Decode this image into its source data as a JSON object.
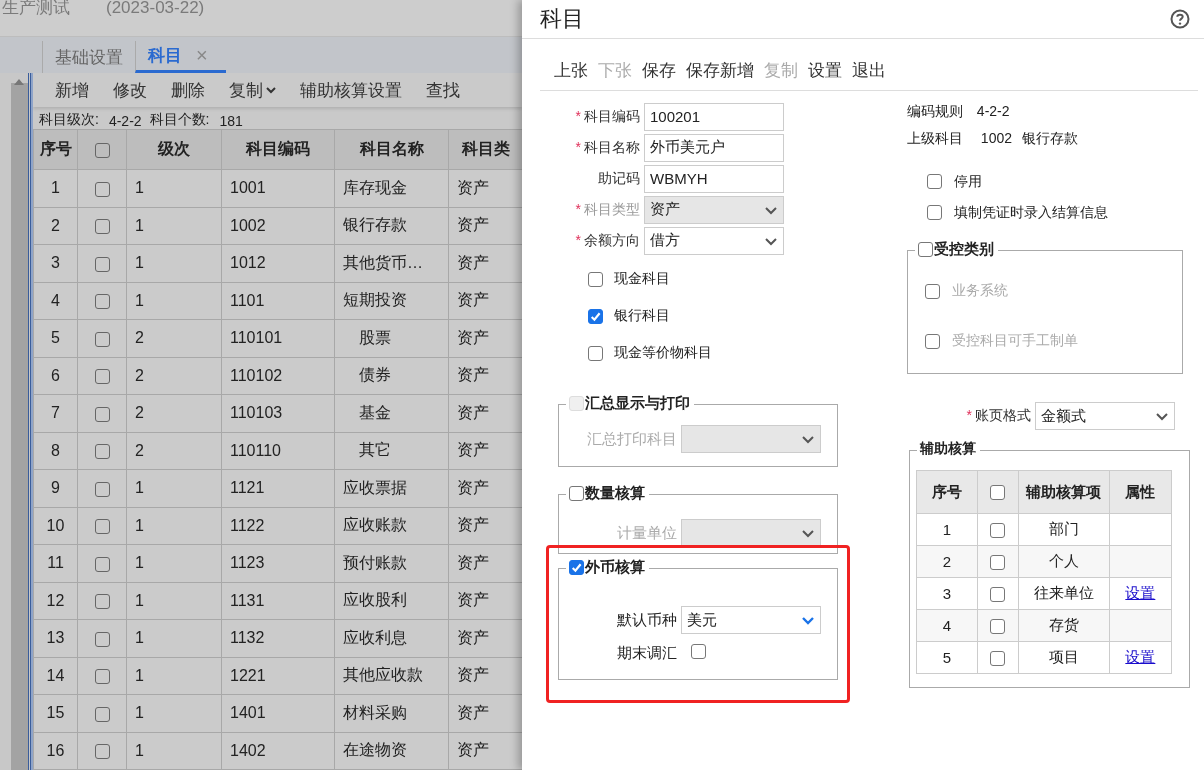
{
  "app": {
    "title": "生产测试",
    "date": "(2023-03-22)"
  },
  "tabs": [
    {
      "label": "基础设置",
      "selected": false
    },
    {
      "label": "科目",
      "selected": true,
      "close": "×"
    }
  ],
  "toolbar": [
    {
      "label": "新增"
    },
    {
      "label": "修改"
    },
    {
      "label": "删除"
    },
    {
      "label": "复制",
      "dropdown": true
    },
    {
      "label": "辅助核算设置"
    },
    {
      "label": "查找"
    }
  ],
  "summary": {
    "levels_label": "科目级次:",
    "levels_value": "4-2-2",
    "count_label": "科目个数:",
    "count_value": "181"
  },
  "table": {
    "columns": [
      "序号",
      "级次",
      "科目编码",
      "科目名称",
      "科目类"
    ],
    "header_checked": false,
    "rows": [
      {
        "no": "1",
        "checked": false,
        "grade": "1",
        "code": "1001",
        "name": "库存现金",
        "type": "资产",
        "kind": "top"
      },
      {
        "no": "2",
        "checked": false,
        "grade": "1",
        "code": "1002",
        "name": "银行存款",
        "type": "资产",
        "kind": "top"
      },
      {
        "no": "3",
        "checked": false,
        "grade": "1",
        "code": "1012",
        "name": "其他货币…",
        "type": "资产",
        "kind": "top"
      },
      {
        "no": "4",
        "checked": false,
        "grade": "1",
        "code": "1101",
        "name": "短期投资",
        "type": "资产",
        "kind": "top"
      },
      {
        "no": "5",
        "checked": false,
        "grade": "2",
        "code": "110101",
        "name": "股票",
        "type": "资产",
        "kind": "child"
      },
      {
        "no": "6",
        "checked": false,
        "grade": "2",
        "code": "110102",
        "name": "债券",
        "type": "资产",
        "kind": "child"
      },
      {
        "no": "7",
        "checked": false,
        "grade": "2",
        "code": "110103",
        "name": "基金",
        "type": "资产",
        "kind": "child"
      },
      {
        "no": "8",
        "checked": false,
        "grade": "2",
        "code": "110110",
        "name": "其它",
        "type": "资产",
        "kind": "child"
      },
      {
        "no": "9",
        "checked": false,
        "grade": "1",
        "code": "1121",
        "name": "应收票据",
        "type": "资产",
        "kind": "top"
      },
      {
        "no": "10",
        "checked": false,
        "grade": "1",
        "code": "1122",
        "name": "应收账款",
        "type": "资产",
        "kind": "top"
      },
      {
        "no": "11",
        "checked": false,
        "grade": "1",
        "code": "1123",
        "name": "预付账款",
        "type": "资产",
        "kind": "top"
      },
      {
        "no": "12",
        "checked": false,
        "grade": "1",
        "code": "1131",
        "name": "应收股利",
        "type": "资产",
        "kind": "top"
      },
      {
        "no": "13",
        "checked": false,
        "grade": "1",
        "code": "1132",
        "name": "应收利息",
        "type": "资产",
        "kind": "top"
      },
      {
        "no": "14",
        "checked": false,
        "grade": "1",
        "code": "1221",
        "name": "其他应收款",
        "type": "资产",
        "kind": "top"
      },
      {
        "no": "15",
        "checked": false,
        "grade": "1",
        "code": "1401",
        "name": "材料采购",
        "type": "资产",
        "kind": "top"
      },
      {
        "no": "16",
        "checked": false,
        "grade": "1",
        "code": "1402",
        "name": "在途物资",
        "type": "资产",
        "kind": "top"
      }
    ]
  },
  "dialog": {
    "title": "科目",
    "toolbar": [
      {
        "label": "上张",
        "disabled": false
      },
      {
        "label": "下张",
        "disabled": true
      },
      {
        "label": "保存",
        "disabled": false
      },
      {
        "label": "保存新增",
        "disabled": false
      },
      {
        "label": "复制",
        "disabled": true
      },
      {
        "label": "设置",
        "disabled": false
      },
      {
        "label": "退出",
        "disabled": false
      }
    ],
    "fields": [
      {
        "label": "科目编码",
        "required_mark": "*",
        "kind": "text",
        "value": "100201"
      },
      {
        "label": "科目名称",
        "required_mark": "*",
        "kind": "text",
        "value": "外币美元户"
      },
      {
        "label": "助记码",
        "kind": "text",
        "value": "WBMYH"
      },
      {
        "label": "科目类型",
        "required_mark": "*",
        "disabled": true,
        "kind": "select",
        "value": "资产"
      },
      {
        "label": "余额方向",
        "required_mark": "*",
        "disabled": false,
        "kind": "select",
        "value": "借方"
      }
    ],
    "flags": [
      {
        "label": "现金科目",
        "checked": false
      },
      {
        "label": "银行科目",
        "checked": true
      },
      {
        "label": "现金等价物科目",
        "checked": false
      }
    ],
    "summary_print": {
      "title": "汇总显示与打印",
      "checked": false,
      "disabled": true,
      "field_label": "汇总打印科目"
    },
    "quantity": {
      "title": "数量核算",
      "checked": false,
      "field_label": "计量单位"
    },
    "foreign": {
      "title": "外币核算",
      "checked": true,
      "highlighted": true,
      "currency_label": "默认币种",
      "currency": "美元",
      "revalue_label": "期末调汇",
      "revalue_checked": false
    },
    "code_rule": {
      "label": "编码规则",
      "value": "4-2-2"
    },
    "parent": {
      "label": "上级科目",
      "code": "1002",
      "name": "银行存款"
    },
    "options": [
      {
        "label": "停用",
        "checked": false
      },
      {
        "label": "填制凭证时录入结算信息",
        "checked": false
      }
    ],
    "controlled": {
      "title": "受控类别",
      "checked": false,
      "items": [
        {
          "label": "业务系统",
          "checked": false,
          "disabled": true
        },
        {
          "label": "受控科目可手工制单",
          "checked": false,
          "disabled": true
        }
      ]
    },
    "ledger": {
      "label": "账页格式",
      "required_mark": "*",
      "value": "金额式"
    },
    "aux": {
      "title": "辅助核算",
      "columns": [
        "序号",
        "辅助核算项",
        "属性"
      ],
      "header_checked": false,
      "rows": [
        {
          "no": "1",
          "checked": false,
          "item": "部门"
        },
        {
          "no": "2",
          "checked": false,
          "item": "个人"
        },
        {
          "no": "3",
          "checked": false,
          "item": "往来单位",
          "link": "设置"
        },
        {
          "no": "4",
          "checked": false,
          "item": "存货"
        },
        {
          "no": "5",
          "checked": false,
          "item": "项目",
          "link": "设置"
        }
      ]
    }
  }
}
